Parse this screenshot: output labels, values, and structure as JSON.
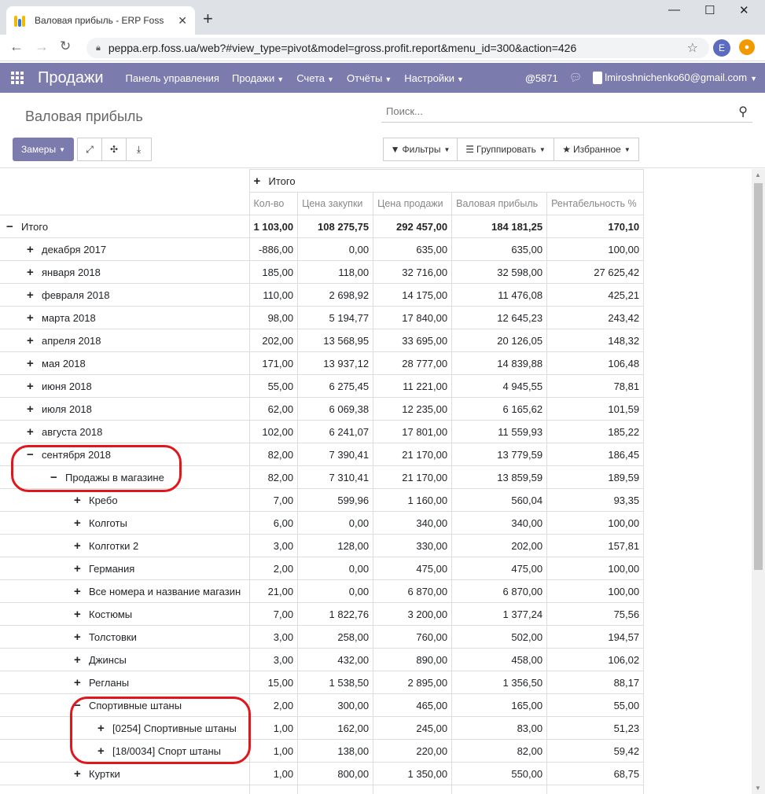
{
  "browser": {
    "tab_title": "Валовая прибыль - ERP Foss",
    "url": "peppa.erp.foss.ua/web?#view_type=pivot&model=gross.profit.report&menu_id=300&action=426",
    "profile_initial": "E"
  },
  "topbar": {
    "brand": "Продажи",
    "menus": [
      "Панель управления",
      "Продажи",
      "Счета",
      "Отчёты",
      "Настройки"
    ],
    "discuss_count": "5871",
    "user": "lmiroshnichenko60@gmail.com"
  },
  "control": {
    "title": "Валовая прибыль",
    "search_placeholder": "Поиск...",
    "measures": "Замеры",
    "filters": "Фильтры",
    "groupby": "Группировать",
    "favorites": "Избранное"
  },
  "pivot": {
    "col_group": "Итого",
    "headers": [
      "Кол-во",
      "Цена закупки",
      "Цена продажи",
      "Валовая прибыль",
      "Рентабельность %"
    ],
    "rows": [
      {
        "label": "Итого",
        "level": 0,
        "sign": "−",
        "values": [
          "1 103,00",
          "108 275,75",
          "292 457,00",
          "184 181,25",
          "170,10"
        ]
      },
      {
        "label": "декабря 2017",
        "level": 1,
        "sign": "+",
        "values": [
          "-886,00",
          "0,00",
          "635,00",
          "635,00",
          "100,00"
        ]
      },
      {
        "label": "января 2018",
        "level": 1,
        "sign": "+",
        "values": [
          "185,00",
          "118,00",
          "32 716,00",
          "32 598,00",
          "27 625,42"
        ]
      },
      {
        "label": "февраля 2018",
        "level": 1,
        "sign": "+",
        "values": [
          "110,00",
          "2 698,92",
          "14 175,00",
          "11 476,08",
          "425,21"
        ]
      },
      {
        "label": "марта 2018",
        "level": 1,
        "sign": "+",
        "values": [
          "98,00",
          "5 194,77",
          "17 840,00",
          "12 645,23",
          "243,42"
        ]
      },
      {
        "label": "апреля 2018",
        "level": 1,
        "sign": "+",
        "values": [
          "202,00",
          "13 568,95",
          "33 695,00",
          "20 126,05",
          "148,32"
        ]
      },
      {
        "label": "мая 2018",
        "level": 1,
        "sign": "+",
        "values": [
          "171,00",
          "13 937,12",
          "28 777,00",
          "14 839,88",
          "106,48"
        ]
      },
      {
        "label": "июня 2018",
        "level": 1,
        "sign": "+",
        "values": [
          "55,00",
          "6 275,45",
          "11 221,00",
          "4 945,55",
          "78,81"
        ]
      },
      {
        "label": "июля 2018",
        "level": 1,
        "sign": "+",
        "values": [
          "62,00",
          "6 069,38",
          "12 235,00",
          "6 165,62",
          "101,59"
        ]
      },
      {
        "label": "августа 2018",
        "level": 1,
        "sign": "+",
        "values": [
          "102,00",
          "6 241,07",
          "17 801,00",
          "11 559,93",
          "185,22"
        ]
      },
      {
        "label": "сентября 2018",
        "level": 1,
        "sign": "−",
        "values": [
          "82,00",
          "7 390,41",
          "21 170,00",
          "13 779,59",
          "186,45"
        ]
      },
      {
        "label": "Продажы в магазине",
        "level": 2,
        "sign": "−",
        "values": [
          "82,00",
          "7 310,41",
          "21 170,00",
          "13 859,59",
          "189,59"
        ]
      },
      {
        "label": "Кребо",
        "level": 3,
        "sign": "+",
        "values": [
          "7,00",
          "599,96",
          "1 160,00",
          "560,04",
          "93,35"
        ]
      },
      {
        "label": "Колготы",
        "level": 3,
        "sign": "+",
        "values": [
          "6,00",
          "0,00",
          "340,00",
          "340,00",
          "100,00"
        ]
      },
      {
        "label": "Колготки 2",
        "level": 3,
        "sign": "+",
        "values": [
          "3,00",
          "128,00",
          "330,00",
          "202,00",
          "157,81"
        ]
      },
      {
        "label": "Германия",
        "level": 3,
        "sign": "+",
        "values": [
          "2,00",
          "0,00",
          "475,00",
          "475,00",
          "100,00"
        ]
      },
      {
        "label": "Все номера и название магазин",
        "level": 3,
        "sign": "+",
        "values": [
          "21,00",
          "0,00",
          "6 870,00",
          "6 870,00",
          "100,00"
        ]
      },
      {
        "label": "Костюмы",
        "level": 3,
        "sign": "+",
        "values": [
          "7,00",
          "1 822,76",
          "3 200,00",
          "1 377,24",
          "75,56"
        ]
      },
      {
        "label": "Толстовки",
        "level": 3,
        "sign": "+",
        "values": [
          "3,00",
          "258,00",
          "760,00",
          "502,00",
          "194,57"
        ]
      },
      {
        "label": "Джинсы",
        "level": 3,
        "sign": "+",
        "values": [
          "3,00",
          "432,00",
          "890,00",
          "458,00",
          "106,02"
        ]
      },
      {
        "label": "Регланы",
        "level": 3,
        "sign": "+",
        "values": [
          "15,00",
          "1 538,50",
          "2 895,00",
          "1 356,50",
          "88,17"
        ]
      },
      {
        "label": "Спортивные штаны",
        "level": 3,
        "sign": "−",
        "values": [
          "2,00",
          "300,00",
          "465,00",
          "165,00",
          "55,00"
        ]
      },
      {
        "label": "[0254] Спортивные штаны",
        "level": 4,
        "sign": "+",
        "values": [
          "1,00",
          "162,00",
          "245,00",
          "83,00",
          "51,23"
        ]
      },
      {
        "label": "[18/0034] Спорт штаны",
        "level": 4,
        "sign": "+",
        "values": [
          "1,00",
          "138,00",
          "220,00",
          "82,00",
          "59,42"
        ]
      },
      {
        "label": "Куртки",
        "level": 3,
        "sign": "+",
        "values": [
          "1,00",
          "800,00",
          "1 350,00",
          "550,00",
          "68,75"
        ]
      },
      {
        "label": "",
        "level": 3,
        "sign": "",
        "values": [
          "",
          "",
          "",
          "",
          ""
        ]
      }
    ]
  }
}
